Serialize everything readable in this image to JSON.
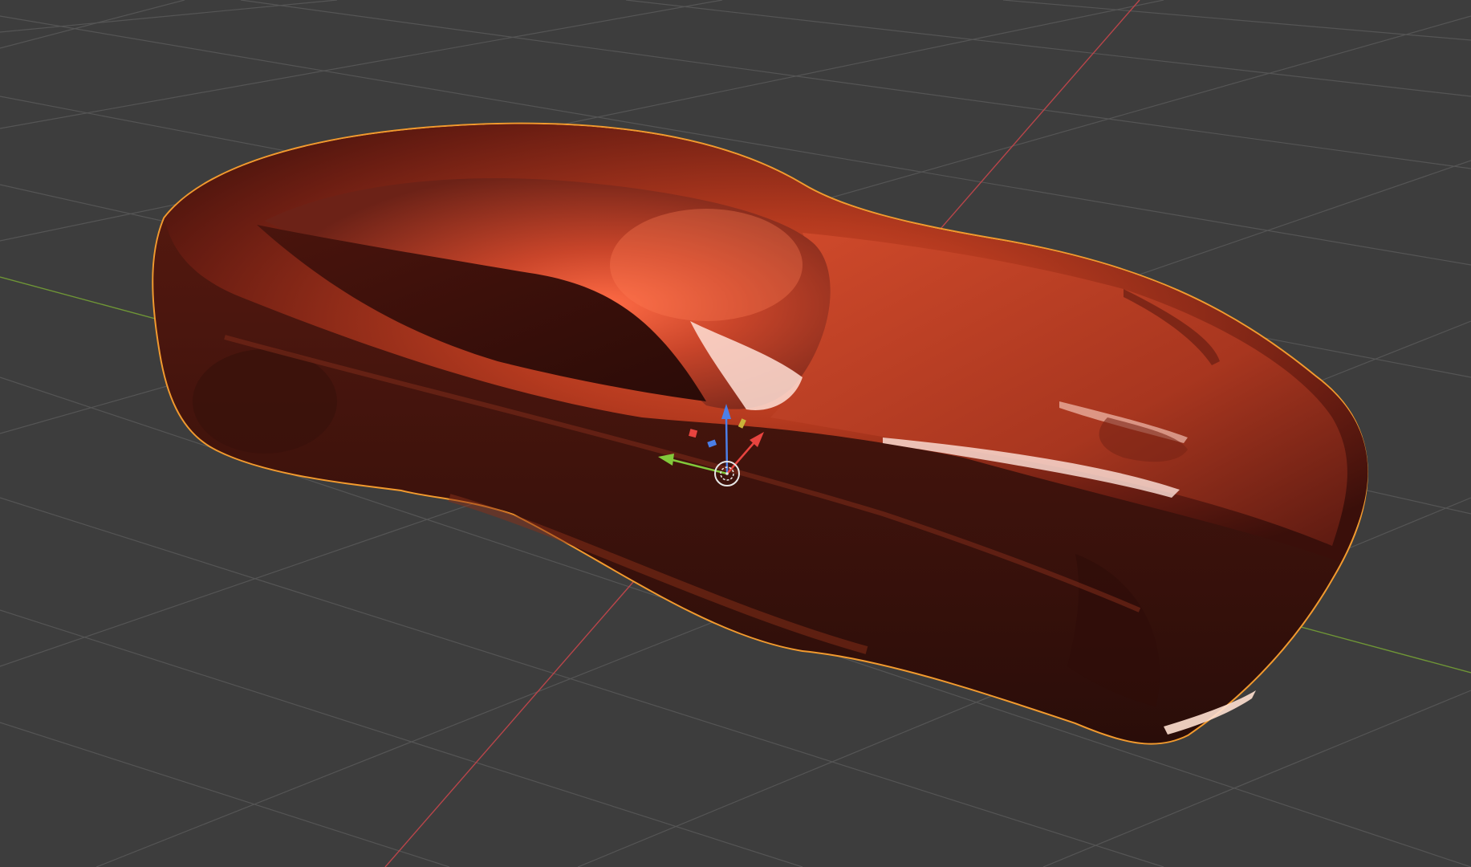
{
  "viewport": {
    "background_color": "#3d3d3d",
    "grid_line_color": "#5a5a5a",
    "x_axis_color": "#b8454a",
    "y_axis_color": "#6f9636",
    "selection_outline_color": "#f29a2e"
  },
  "object": {
    "icon": "car-body-mesh",
    "material_color": "#b8371f",
    "selected": true
  },
  "gizmo": {
    "icons": [
      "z-axis-arrow-icon",
      "y-axis-arrow-icon",
      "x-axis-arrow-icon",
      "origin-pivot-icon",
      "plane-handle-icon"
    ],
    "colors": {
      "x": "#e8443f",
      "y": "#82c93b",
      "z": "#4b7fe8",
      "origin": "#e6e6e6"
    }
  }
}
